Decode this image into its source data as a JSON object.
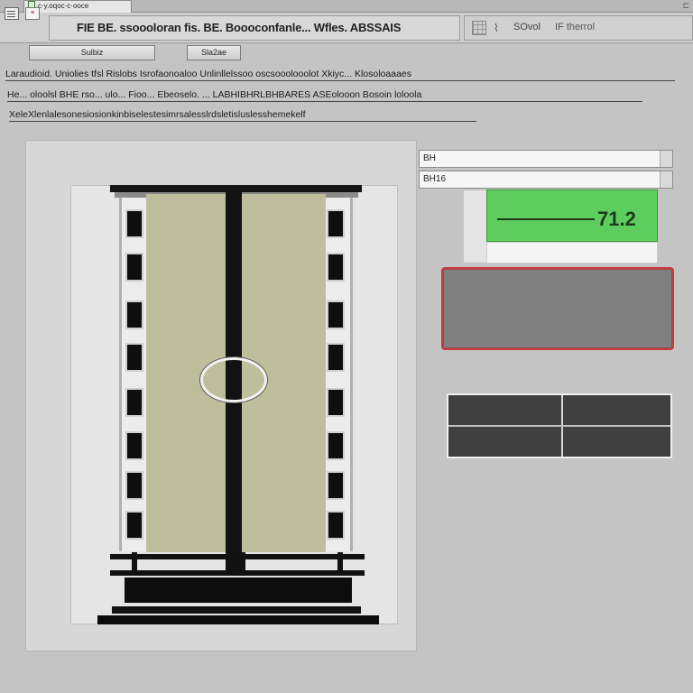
{
  "tab": {
    "label": "c·y.oqoc·c·ooce"
  },
  "title_bar": {
    "title": "FIE BE. ssoooloran fis. BE. Boooconfanle... Wfles. ABSSAIS"
  },
  "toolbar_right": {
    "label1": "SOvol",
    "label2": "IF therrol"
  },
  "buttons": {
    "button_a": "Sulbiz",
    "button_b": "Sla2ae"
  },
  "instructions": {
    "line1": "Laraudioid. Uniolies tfsl Rislobs Isrofaonoaloo Unlinllelssoo oscsooolooolot Xkiyc... Klosoloaaaes",
    "line2": "He... oloolsl BHE rso... ulo... Fioo... Ebeoselo. ... LABHIBHRLBHBARES ASEolooon Bosoin loloola",
    "line3": "XeleXlenlalesonesiosionkinbiselestesimrsalesslrdsletisluslesshemekelf"
  },
  "fields": {
    "field1": "BH",
    "field2": "BH16"
  },
  "readout": {
    "value": "71.2"
  },
  "colors": {
    "readout_bg": "#5dcd5d",
    "alert_border": "#c63b3b",
    "door_panel": "#bebe9c"
  }
}
